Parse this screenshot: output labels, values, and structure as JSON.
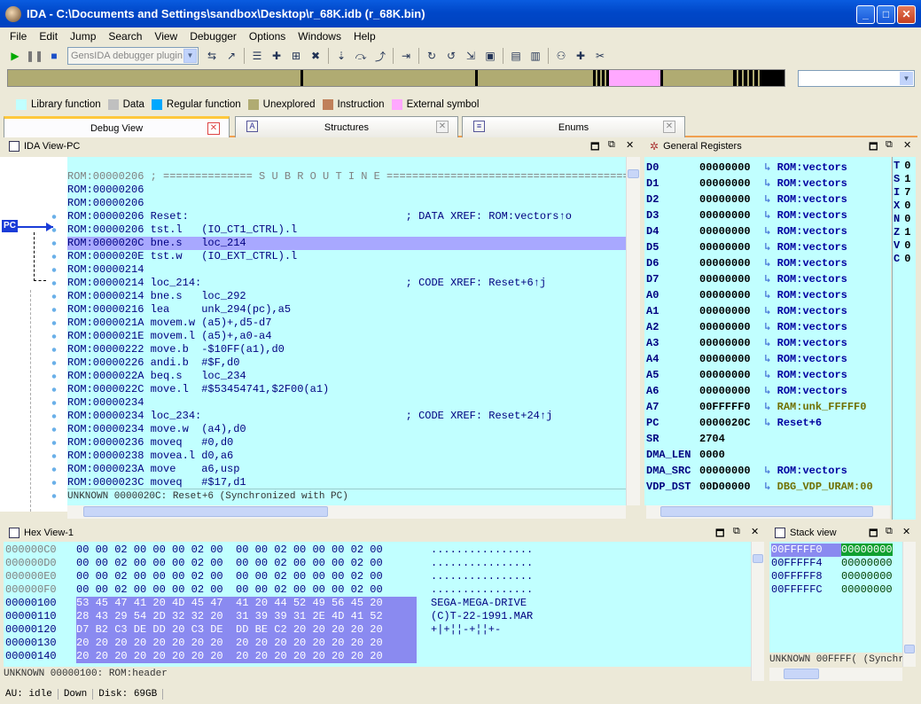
{
  "window": {
    "title": "IDA - C:\\Documents and Settings\\sandbox\\Desktop\\r_68K.idb (r_68K.bin)"
  },
  "menu": [
    "File",
    "Edit",
    "Jump",
    "Search",
    "View",
    "Debugger",
    "Options",
    "Windows",
    "Help"
  ],
  "toolbar": {
    "debugger_combo": "GensIDA debugger plugin"
  },
  "legend": [
    {
      "label": "Library function",
      "color": "#c1ffff"
    },
    {
      "label": "Data",
      "color": "#c0c0c0"
    },
    {
      "label": "Regular function",
      "color": "#00a8ff"
    },
    {
      "label": "Unexplored",
      "color": "#b0ab72"
    },
    {
      "label": "Instruction",
      "color": "#c0805a"
    },
    {
      "label": "External symbol",
      "color": "#ffa8ff"
    }
  ],
  "tabs": [
    "Debug View",
    "Structures",
    "Enums"
  ],
  "ida_view": {
    "title": "IDA View-PC",
    "pc_label": "PC",
    "lines": [
      "ROM:00000206 ; ============== S U B R O U T I N E =======================================",
      "ROM:00000206",
      "ROM:00000206",
      "ROM:00000206 Reset:                                  ; DATA XREF: ROM:vectors↑o",
      "ROM:00000206 tst.l   (IO_CT1_CTRL).l",
      "ROM:0000020C bne.s   loc_214",
      "ROM:0000020E tst.w   (IO_EXT_CTRL).l",
      "ROM:00000214",
      "ROM:00000214 loc_214:                                ; CODE XREF: Reset+6↑j",
      "ROM:00000214 bne.s   loc_292",
      "ROM:00000216 lea     unk_294(pc),a5",
      "ROM:0000021A movem.w (a5)+,d5-d7",
      "ROM:0000021E movem.l (a5)+,a0-a4",
      "ROM:00000222 move.b  -$10FF(a1),d0",
      "ROM:00000226 andi.b  #$F,d0",
      "ROM:0000022A beq.s   loc_234",
      "ROM:0000022C move.l  #$53454741,$2F00(a1)",
      "ROM:00000234",
      "ROM:00000234 loc_234:                                ; CODE XREF: Reset+24↑j",
      "ROM:00000234 move.w  (a4),d0",
      "ROM:00000236 moveq   #0,d0",
      "ROM:00000238 movea.l d0,a6",
      "ROM:0000023A move    a6,usp",
      "ROM:0000023C moveq   #$17,d1"
    ],
    "status": "UNKNOWN 0000020C: Reset+6 (Synchronized with PC)"
  },
  "registers": {
    "title": "General Registers",
    "rows": [
      {
        "name": "D0",
        "value": "00000000",
        "ref": "ROM:vectors"
      },
      {
        "name": "D1",
        "value": "00000000",
        "ref": "ROM:vectors"
      },
      {
        "name": "D2",
        "value": "00000000",
        "ref": "ROM:vectors"
      },
      {
        "name": "D3",
        "value": "00000000",
        "ref": "ROM:vectors"
      },
      {
        "name": "D4",
        "value": "00000000",
        "ref": "ROM:vectors"
      },
      {
        "name": "D5",
        "value": "00000000",
        "ref": "ROM:vectors"
      },
      {
        "name": "D6",
        "value": "00000000",
        "ref": "ROM:vectors"
      },
      {
        "name": "D7",
        "value": "00000000",
        "ref": "ROM:vectors"
      },
      {
        "name": "A0",
        "value": "00000000",
        "ref": "ROM:vectors"
      },
      {
        "name": "A1",
        "value": "00000000",
        "ref": "ROM:vectors"
      },
      {
        "name": "A2",
        "value": "00000000",
        "ref": "ROM:vectors"
      },
      {
        "name": "A3",
        "value": "00000000",
        "ref": "ROM:vectors"
      },
      {
        "name": "A4",
        "value": "00000000",
        "ref": "ROM:vectors"
      },
      {
        "name": "A5",
        "value": "00000000",
        "ref": "ROM:vectors"
      },
      {
        "name": "A6",
        "value": "00000000",
        "ref": "ROM:vectors"
      },
      {
        "name": "A7",
        "value": "00FFFFF0",
        "ref": "RAM:unk_FFFFF0"
      },
      {
        "name": "PC",
        "value": "0000020C",
        "ref": "Reset+6"
      },
      {
        "name": "SR",
        "value": "2704",
        "ref": ""
      },
      {
        "name": "DMA_LEN",
        "value": "0000",
        "ref": ""
      },
      {
        "name": "DMA_SRC",
        "value": "00000000",
        "ref": "ROM:vectors"
      },
      {
        "name": "VDP_DST",
        "value": "00D00000",
        "ref": "DBG_VDP_URAM:00"
      }
    ],
    "flags": [
      {
        "name": "T",
        "value": "0"
      },
      {
        "name": "S",
        "value": "1"
      },
      {
        "name": "I",
        "value": "7"
      },
      {
        "name": "X",
        "value": "0"
      },
      {
        "name": "N",
        "value": "0"
      },
      {
        "name": "Z",
        "value": "1"
      },
      {
        "name": "V",
        "value": "0"
      },
      {
        "name": "C",
        "value": "0"
      }
    ]
  },
  "hex_view": {
    "title": "Hex View-1",
    "rows": [
      {
        "addr": "000000C0",
        "bytes": "00 00 02 00 00 00 02 00  00 00 02 00 00 00 02 00",
        "ascii": "................",
        "sel": false
      },
      {
        "addr": "000000D0",
        "bytes": "00 00 02 00 00 00 02 00  00 00 02 00 00 00 02 00",
        "ascii": "................",
        "sel": false
      },
      {
        "addr": "000000E0",
        "bytes": "00 00 02 00 00 00 02 00  00 00 02 00 00 00 02 00",
        "ascii": "................",
        "sel": false
      },
      {
        "addr": "000000F0",
        "bytes": "00 00 02 00 00 00 02 00  00 00 02 00 00 00 02 00",
        "ascii": "................",
        "sel": false
      },
      {
        "addr": "00000100",
        "bytes": "53 45 47 41 20 4D 45 47  41 20 44 52 49 56 45 20",
        "ascii": "SEGA-MEGA-DRIVE ",
        "sel": true
      },
      {
        "addr": "00000110",
        "bytes": "28 43 29 54 2D 32 32 20  31 39 39 31 2E 4D 41 52",
        "ascii": "(C)T-22-1991.MAR",
        "sel": true
      },
      {
        "addr": "00000120",
        "bytes": "D7 B2 C3 DE DD 20 C3 DE  DD BE C2 20 20 20 20 20",
        "ascii": "+|+¦¦-+¦¦+-     ",
        "sel": true
      },
      {
        "addr": "00000130",
        "bytes": "20 20 20 20 20 20 20 20  20 20 20 20 20 20 20 20",
        "ascii": "                ",
        "sel": true
      },
      {
        "addr": "00000140",
        "bytes": "20 20 20 20 20 20 20 20  20 20 20 20 20 20 20 20",
        "ascii": "                ",
        "sel": true
      }
    ],
    "status": "UNKNOWN 00000100: ROM:header"
  },
  "stack_view": {
    "title": "Stack view",
    "rows": [
      {
        "addr": "00FFFFF0",
        "value": "00000000"
      },
      {
        "addr": "00FFFFF4",
        "value": "00000000"
      },
      {
        "addr": "00FFFFF8",
        "value": "00000000"
      },
      {
        "addr": "00FFFFFC",
        "value": "00000000"
      }
    ],
    "status": "UNKNOWN 00FFFF( (Synchr"
  },
  "statusbar": {
    "au": "AU:  idle",
    "dir": "Down",
    "disk": "Disk: 69GB"
  }
}
